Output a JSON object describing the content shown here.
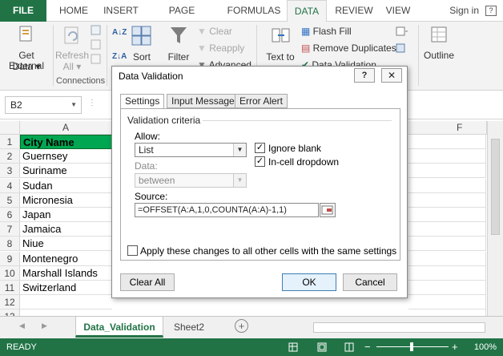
{
  "ribbon_tabs": [
    "FILE",
    "HOME",
    "INSERT",
    "PAGE LAYOUT",
    "FORMULAS",
    "DATA",
    "REVIEW",
    "VIEW"
  ],
  "active_tab": "DATA",
  "signin": "Sign in",
  "signin_icon": "?",
  "ribbon": {
    "get_external_data": "Get External Data ▾",
    "get_external_data_line1": "Get External",
    "get_external_data_line2": "Data ▾",
    "refresh_line1": "Refresh",
    "refresh_line2": "All ▾",
    "connections_group": "Connections",
    "sort": "Sort",
    "filter": "Filter",
    "clear": "Clear",
    "reapply": "Reapply",
    "advanced": "Advanced",
    "text_to_columns_line1": "Text to",
    "flash_fill": "Flash Fill",
    "remove_duplicates": "Remove Duplicates",
    "data_validation": "Data Validation",
    "outline": "Outline",
    "sort_az": "A↓Z",
    "sort_za": "Z↓A"
  },
  "formula_bar": {
    "name_box": "B2",
    "name_box_arrow": "▼",
    "dots": "⋮"
  },
  "columns": [
    "A",
    "F"
  ],
  "rows": [
    "1",
    "2",
    "3",
    "4",
    "5",
    "6",
    "7",
    "8",
    "9",
    "10",
    "11",
    "12",
    "13"
  ],
  "cells": [
    "City Name",
    "Guernsey",
    "Suriname",
    "Sudan",
    "Micronesia",
    "Japan",
    "Jamaica",
    "Niue",
    "Montenegro",
    "Marshall Islands",
    "Switzerland",
    "",
    ""
  ],
  "sheet_tabs": {
    "active": "Data_Validation",
    "other": "Sheet2",
    "add": "+",
    "nav_left": "◀",
    "nav_right": "▶"
  },
  "status": {
    "ready": "READY",
    "zoom": "100%",
    "zoom_minus": "−",
    "zoom_plus": "+"
  },
  "dialog": {
    "title": "Data Validation",
    "help": "?",
    "close": "✕",
    "tabs": [
      "Settings",
      "Input Message",
      "Error Alert"
    ],
    "validation_criteria": "Validation criteria",
    "allow_label": "Allow:",
    "allow_value": "List",
    "data_label": "Data:",
    "data_value": "between",
    "ignore_blank": "Ignore blank",
    "in_cell_dropdown": "In-cell dropdown",
    "source_label": "Source:",
    "source_value": "=OFFSET(A:A,1,0,COUNTA(A:A)-1,1)",
    "apply_all": "Apply these changes to all other cells with the same settings",
    "clear_all": "Clear All",
    "ok": "OK",
    "cancel": "Cancel",
    "check_mark": "✓",
    "dropdown_arrow": "▼"
  },
  "colors": {
    "excel_green": "#217346",
    "header_cell_green": "#00a651"
  }
}
